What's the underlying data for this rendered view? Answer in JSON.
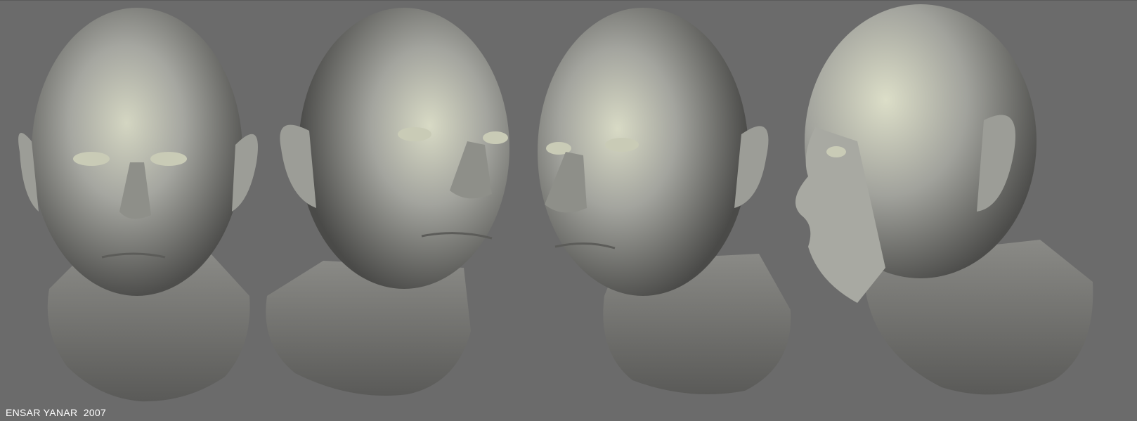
{
  "credit": {
    "text": "ENSAR YANAR  2007"
  },
  "render": {
    "views": [
      "front",
      "three-quarter-left",
      "three-quarter-right",
      "profile"
    ]
  },
  "colors": {
    "background": "#6b6b6b",
    "clay_light": "#cfd1bd",
    "clay_mid": "#9a9a94",
    "clay_dark": "#4a4a48"
  }
}
